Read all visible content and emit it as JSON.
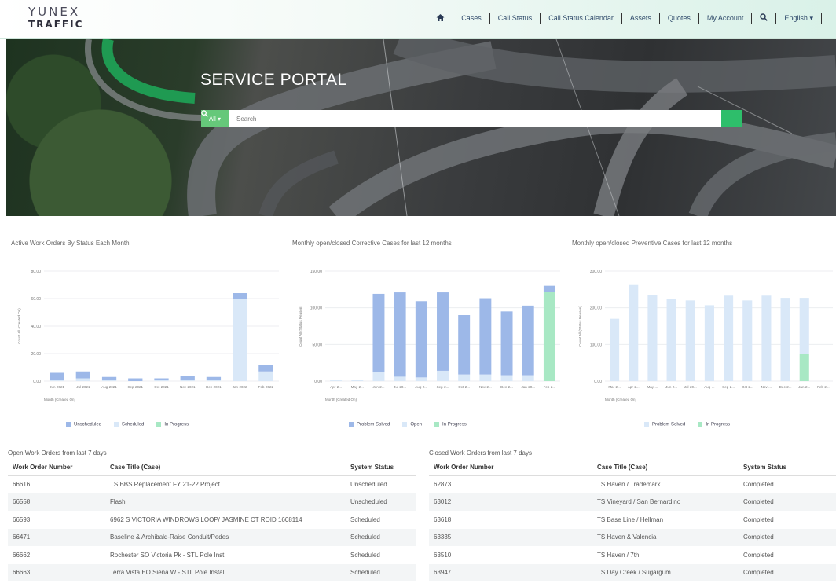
{
  "header": {
    "logo_line1": "YUNEX",
    "logo_line2": "TRAFFIC",
    "nav": [
      "Cases",
      "Call Status",
      "Call Status Calendar",
      "Assets",
      "Quotes",
      "My Account"
    ],
    "language": "English"
  },
  "hero": {
    "title": "SERVICE PORTAL",
    "search_scope": "All",
    "search_placeholder": "Search"
  },
  "colors": {
    "unscheduled": "#9db8e8",
    "scheduled": "#d9e8f8",
    "in_progress": "#a8e8c4",
    "problem_solved": "#9db8e8",
    "open": "#d9e8f8",
    "accent_green": "#2ebe6b"
  },
  "chart_data": [
    {
      "type": "bar",
      "title": "Active Work Orders By Status Each Month",
      "xlabel": "Month (Created On)",
      "ylabel": "Count All (Created On)",
      "ylim": [
        0,
        80
      ],
      "yticks": [
        "0.00",
        "20.00",
        "40.00",
        "60.00",
        "80.00"
      ],
      "categories": [
        "Jun-2021",
        "Jul-2021",
        "Aug-2021",
        "Sep-2021",
        "Oct-2021",
        "Nov-2021",
        "Dec-2021",
        "Jan-2022",
        "Feb-2022"
      ],
      "series": [
        {
          "name": "Unscheduled",
          "values": [
            5,
            5,
            2,
            2,
            1,
            3,
            2,
            4,
            5
          ]
        },
        {
          "name": "Scheduled",
          "values": [
            1,
            2,
            1,
            0,
            1,
            1,
            1,
            60,
            7
          ]
        },
        {
          "name": "In Progress",
          "values": [
            0,
            0,
            0,
            0,
            0,
            0,
            0,
            0,
            0
          ]
        }
      ]
    },
    {
      "type": "bar",
      "title": "Monthly open/closed Corrective Cases for last 12 months",
      "xlabel": "Month (Created On)",
      "ylabel": "Count All (Status Reason)",
      "ylim": [
        0,
        150
      ],
      "yticks": [
        "0.00",
        "50.00",
        "100.00",
        "150.00"
      ],
      "categories": [
        "Apr-2...",
        "May-2...",
        "Jun-2...",
        "Jul-20...",
        "Aug-2...",
        "Sep-2...",
        "Oct-2...",
        "Nov-2...",
        "Dec-2...",
        "Jan-20...",
        "Feb-2..."
      ],
      "series": [
        {
          "name": "Problem Solved",
          "values": [
            0,
            0,
            107,
            115,
            104,
            107,
            81,
            104,
            87,
            95,
            0
          ]
        },
        {
          "name": "Open",
          "values": [
            1,
            2,
            12,
            6,
            5,
            14,
            9,
            9,
            8,
            8,
            0
          ]
        },
        {
          "name": "In Progress",
          "values": [
            0,
            0,
            0,
            0,
            0,
            0,
            0,
            0,
            0,
            0,
            122
          ]
        }
      ],
      "top_caps": [
        0,
        0,
        0,
        0,
        0,
        0,
        0,
        0,
        0,
        0,
        8
      ]
    },
    {
      "type": "bar",
      "title": "Monthly open/closed Preventive Cases for last 12 months",
      "xlabel": "Month (Created On)",
      "ylabel": "Count All (Status Reason)",
      "ylim": [
        0,
        300
      ],
      "yticks": [
        "0.00",
        "100.00",
        "200.00",
        "300.00"
      ],
      "categories": [
        "Mar-2...",
        "Apr-2...",
        "May-...",
        "Jun-2...",
        "Jul-20...",
        "Aug-...",
        "Sep-2...",
        "Oct-2...",
        "Nov-...",
        "Dec-2...",
        "Jan-2...",
        "Feb-2..."
      ],
      "series": [
        {
          "name": "Problem Solved",
          "values": [
            170,
            262,
            235,
            225,
            220,
            207,
            233,
            220,
            233,
            227,
            152,
            0
          ]
        },
        {
          "name": "In Progress",
          "values": [
            0,
            0,
            0,
            0,
            0,
            0,
            0,
            0,
            0,
            0,
            75,
            0
          ]
        }
      ]
    }
  ],
  "legends": {
    "chart1": [
      "Unscheduled",
      "Scheduled",
      "In Progress"
    ],
    "chart2": [
      "Problem Solved",
      "Open",
      "In Progress"
    ],
    "chart3": [
      "Problem Solved",
      "In Progress"
    ]
  },
  "open_table": {
    "title": "Open Work Orders from last 7 days",
    "headers": [
      "Work Order Number",
      "Case Title (Case)",
      "System Status"
    ],
    "rows": [
      [
        "66616",
        "TS BBS Replacement FY 21-22 Project",
        "Unscheduled"
      ],
      [
        "66558",
        "Flash",
        "Unscheduled"
      ],
      [
        "66593",
        "6962 S VICTORIA WINDROWS LOOP/ JASMINE CT ROID 1608114",
        "Scheduled"
      ],
      [
        "66471",
        "Baseline & Archibald-Raise Conduit/Pedes",
        "Scheduled"
      ],
      [
        "66662",
        "Rochester SO Victoria Pk - STL Pole Inst",
        "Scheduled"
      ],
      [
        "66663",
        "Terra Vista EO Siena W - STL Pole Instal",
        "Scheduled"
      ]
    ]
  },
  "closed_table": {
    "title": "Closed Work Orders from last 7 days",
    "headers": [
      "Work Order Number",
      "Case Title (Case)",
      "System Status"
    ],
    "rows": [
      [
        "62873",
        "TS Haven / Trademark",
        "Completed"
      ],
      [
        "63012",
        "TS Vineyard / San Bernardino",
        "Completed"
      ],
      [
        "63618",
        "TS Base Line / Hellman",
        "Completed"
      ],
      [
        "63335",
        "TS Haven & Valencia",
        "Completed"
      ],
      [
        "63510",
        "TS Haven / 7th",
        "Completed"
      ],
      [
        "63947",
        "TS Day Creek / Sugargum",
        "Completed"
      ]
    ]
  }
}
